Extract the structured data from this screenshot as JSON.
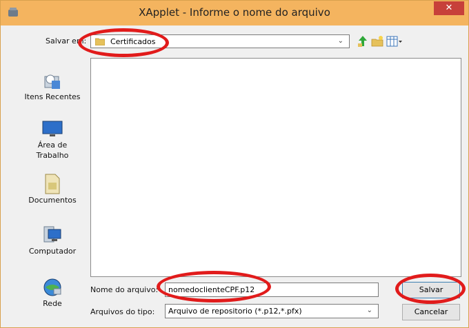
{
  "window": {
    "title": "XApplet - Informe o nome do arquivo",
    "close_label": "✕"
  },
  "toolbar": {
    "save_in_label": "Salvar em:",
    "folder": "Certificados",
    "icons": [
      "up-folder-icon",
      "new-folder-icon",
      "view-menu-icon"
    ]
  },
  "places": [
    {
      "label": "Itens Recentes",
      "icon": "recent-items-icon"
    },
    {
      "label": "Área de Trabalho",
      "icon": "desktop-icon"
    },
    {
      "label": "Documentos",
      "icon": "documents-icon"
    },
    {
      "label": "Computador",
      "icon": "computer-icon"
    },
    {
      "label": "Rede",
      "icon": "network-icon"
    }
  ],
  "form": {
    "filename_label": "Nome do arquivo:",
    "filename_value": "nomedoclienteCPF.p12",
    "filetype_label": "Arquivos do tipo:",
    "filetype_value": "Arquivo de repositorio (*.p12,*.pfx)"
  },
  "buttons": {
    "save": "Salvar",
    "cancel": "Cancelar"
  },
  "colors": {
    "titlebar": "#f4b45f",
    "close": "#c7403a",
    "highlight": "#e11b1b"
  }
}
